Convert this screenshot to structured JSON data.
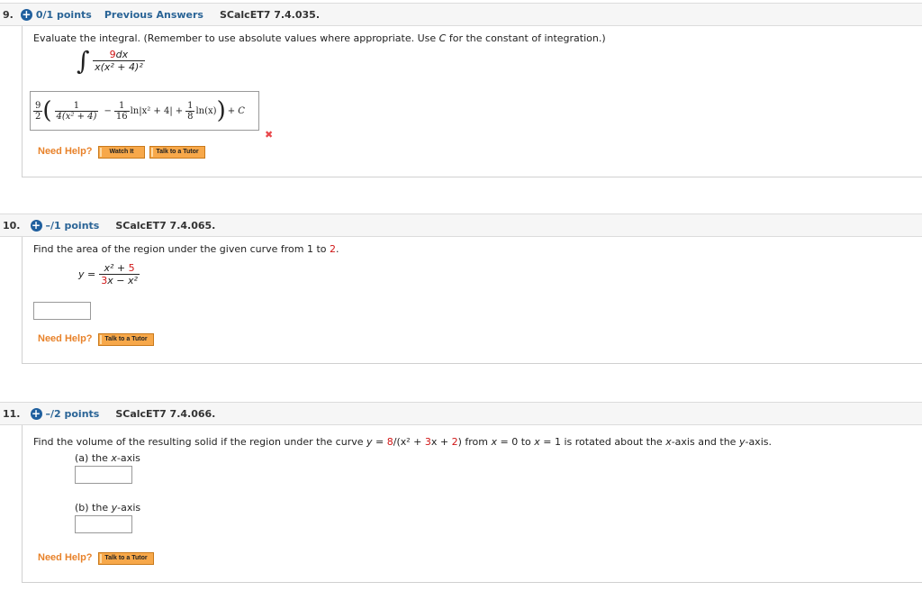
{
  "questions": [
    {
      "number": "9.",
      "points": "0/1 points",
      "previous_answers": "Previous Answers",
      "code": "SCalcET7 7.4.035.",
      "prompt_a": "Evaluate the integral. (Remember to use absolute values where appropriate. Use ",
      "prompt_c": "C",
      "prompt_b": " for the constant of integration.)",
      "integral": {
        "symbol": "∫",
        "num_coef": "9",
        "num_var": "dx",
        "den": "x(x² + 4)²"
      },
      "answer": {
        "coef_num": "9",
        "coef_den": "2",
        "term1_num": "1",
        "term1_den": "4(x² + 4)",
        "minus": "−",
        "term2_num": "1",
        "term2_den": "16",
        "term2_fn": "ln|x² + 4|",
        "plus": "+",
        "term3_num": "1",
        "term3_den": "8",
        "term3_fn": "ln(x)",
        "constant": "+ C"
      },
      "status_icon": "incorrect-x",
      "status_mark": "✖",
      "need_help": "Need Help?",
      "buttons": [
        "Watch It",
        "Talk to a Tutor"
      ]
    },
    {
      "number": "10.",
      "points": "–/1 points",
      "code": "SCalcET7 7.4.065.",
      "prompt_a": "Find the area of the region under the given curve from 1 to ",
      "prompt_red": "2",
      "prompt_b": ".",
      "equation": {
        "lhs": "y =",
        "num_a": "x² + ",
        "num_red": "5",
        "den_red": "3",
        "den_b": "x − x²"
      },
      "answer_value": "",
      "need_help": "Need Help?",
      "buttons": [
        "Talk to a Tutor"
      ]
    },
    {
      "number": "11.",
      "points": "–/2 points",
      "code": "SCalcET7 7.4.066.",
      "prompt_a": "Find the volume of the resulting solid if the region under the curve ",
      "prompt_y": "y",
      "prompt_eq": " = ",
      "prompt_8": "8",
      "prompt_c": "/(x² + ",
      "prompt_3": "3",
      "prompt_d": "x + ",
      "prompt_2": "2",
      "prompt_e": ")  from ",
      "prompt_x1": "x",
      "prompt_f": " = 0 to ",
      "prompt_x2": "x",
      "prompt_g": " = 1 is rotated about the ",
      "prompt_x3": "x",
      "prompt_h": "-axis and the ",
      "prompt_y2": "y",
      "prompt_i": "-axis.",
      "parts": [
        {
          "label_a": "(a) the ",
          "label_var": "x",
          "label_b": "-axis",
          "value": ""
        },
        {
          "label_a": "(b) the ",
          "label_var": "y",
          "label_b": "-axis",
          "value": ""
        }
      ],
      "need_help": "Need Help?",
      "buttons": [
        "Talk to a Tutor"
      ]
    }
  ]
}
